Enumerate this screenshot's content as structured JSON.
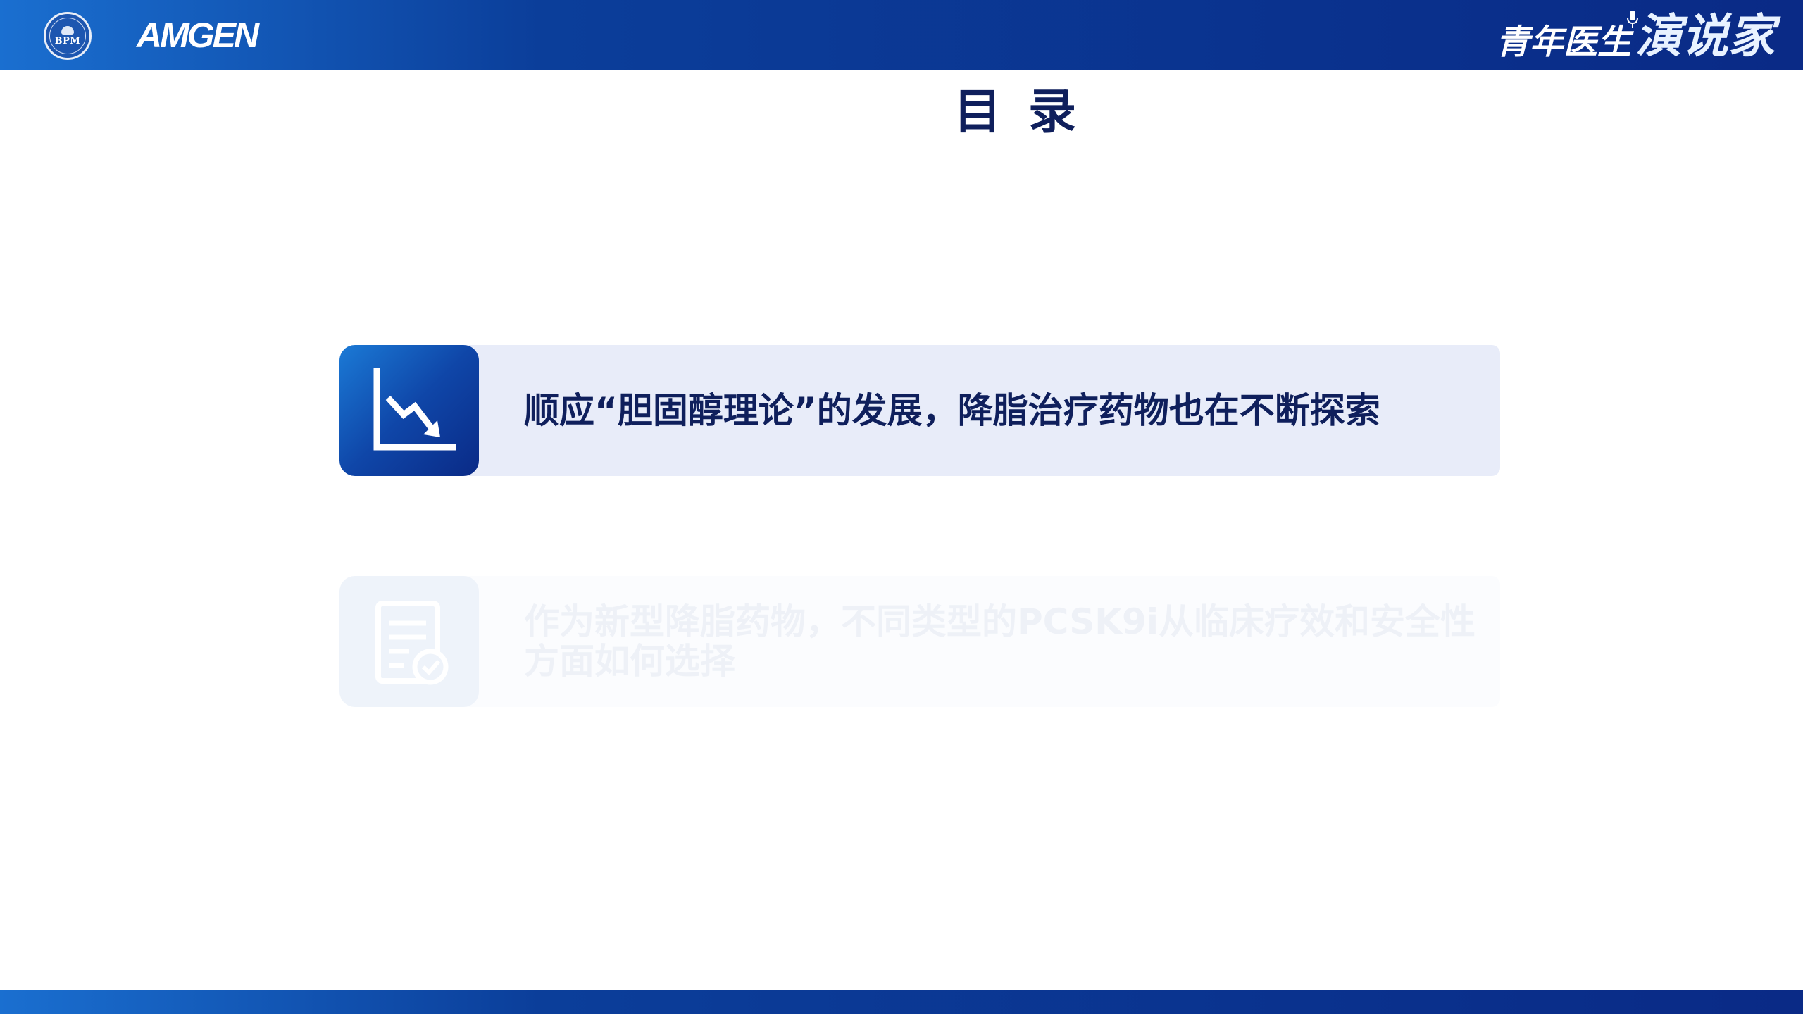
{
  "header": {
    "left_logo_text": "BPM",
    "sponsor_logo": "AMGEN",
    "brand_small": "青年医生",
    "brand_big": "演说家"
  },
  "title": "目录",
  "agenda": [
    {
      "icon": "trend-down-chart-icon",
      "label": "顺应“胆固醇理论”的发展，降脂治疗药物也在不断探索",
      "state": "active"
    },
    {
      "icon": "checklist-document-icon",
      "label": "作为新型降脂药物，不同类型的PCSK9i从临床疗效和安全性方面如何选择",
      "state": "inactive"
    }
  ],
  "colors": {
    "brand_blue": "#0a2a86",
    "accent_blue": "#1a6fd0",
    "active_bar": "#e8ecf9",
    "title_text": "#0f1f5c"
  }
}
